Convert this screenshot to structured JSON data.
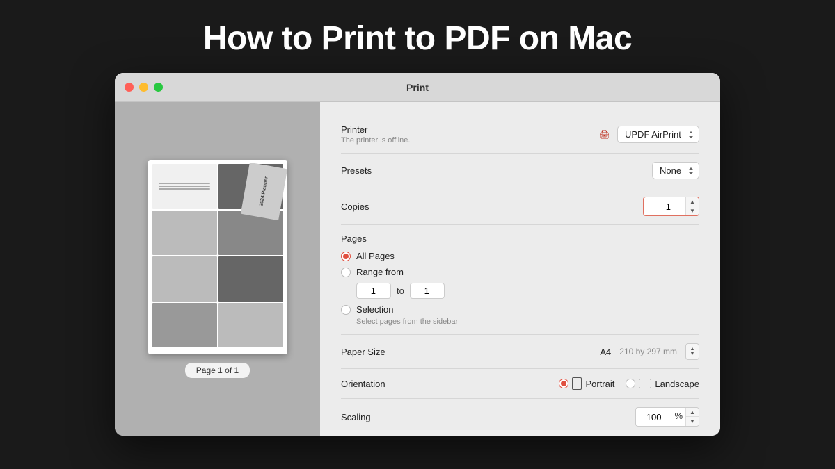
{
  "page": {
    "title": "How to Print to PDF on Mac",
    "background": "#1a1a1a"
  },
  "window": {
    "title": "Print",
    "buttons": {
      "close": "close",
      "minimize": "minimize",
      "maximize": "maximize"
    }
  },
  "preview": {
    "caption": "Page 1 of 1"
  },
  "settings": {
    "printer": {
      "label": "Printer",
      "value": "UPDF AirPrint",
      "sublabel": "The printer is offline."
    },
    "presets": {
      "label": "Presets",
      "value": "None"
    },
    "copies": {
      "label": "Copies",
      "value": "1"
    },
    "pages": {
      "label": "Pages",
      "options": [
        {
          "id": "all",
          "label": "All Pages",
          "selected": true
        },
        {
          "id": "range",
          "label": "Range from",
          "selected": false
        },
        {
          "id": "selection",
          "label": "Selection",
          "selected": false
        }
      ],
      "range_from": "1",
      "range_to_label": "to",
      "range_to": "1",
      "selection_hint": "Select pages from the sidebar"
    },
    "paper_size": {
      "label": "Paper Size",
      "value": "A4",
      "dimensions": "210 by 297 mm"
    },
    "orientation": {
      "label": "Orientation",
      "portrait_label": "Portrait",
      "landscape_label": "Landscape",
      "portrait_selected": true
    },
    "scaling": {
      "label": "Scaling",
      "value": "100",
      "unit": "%"
    }
  }
}
